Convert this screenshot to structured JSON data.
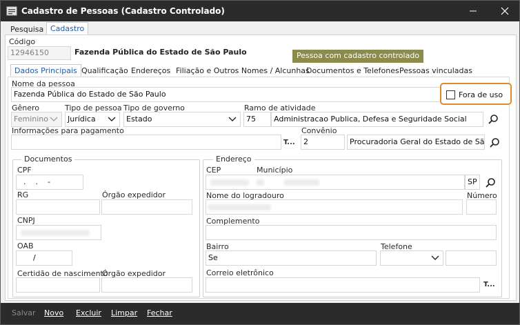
{
  "window": {
    "title": "Cadastro de Pessoas (Cadastro Controlado)",
    "minimize": "—",
    "maximize": "☐",
    "close": "✕"
  },
  "tabs": {
    "main": [
      "Pesquisa",
      "Cadastro"
    ],
    "active_main": "Cadastro",
    "sub": [
      "Dados Principais",
      "Qualificação",
      "Endereços",
      "Filiação e Outros Nomes / Alcunhas",
      "Documentos e Telefones",
      "Pessoas vinculadas"
    ],
    "active_sub": "Dados Principais"
  },
  "header": {
    "codigo_label": "Código",
    "codigo_value": "12946150",
    "entity_name": "Fazenda Pública do Estado de São Paulo",
    "badge": "Pessoa com cadastro controlado"
  },
  "form": {
    "nome_label": "Nome da pessoa",
    "nome_value": "Fazenda Pública do Estado de São Paulo",
    "fora_de_uso_label": "Fora de uso",
    "fora_de_uso_checked": false,
    "genero_label": "Gênero",
    "genero_value": "Feminino",
    "tipo_pessoa_label": "Tipo de pessoa",
    "tipo_pessoa_value": "Jurídica",
    "tipo_governo_label": "Tipo de governo",
    "tipo_governo_value": "Estado",
    "ramo_label": "Ramo de atividade",
    "ramo_code": "75",
    "ramo_desc": "Administracao Publica, Defesa e Seguridade Social",
    "info_pagamento_label": "Informações para pagamento",
    "info_pagamento_btn": "T...",
    "convenio_label": "Convênio",
    "convenio_code": "2",
    "convenio_desc": "Procuradoria Geral do Estado de São P"
  },
  "documentos": {
    "title": "Documentos",
    "cpf_label": "CPF",
    "cpf_value": "  .    .    -",
    "rg_label": "RG",
    "orgao_expedidor_label": "Órgão expedidor",
    "cnpj_label": "CNPJ",
    "oab_label": "OAB",
    "oab_value": "/",
    "certidao_label": "Certidão de nascimento",
    "orgao_expedidor2_label": "Órgão expedidor"
  },
  "endereco": {
    "title": "Endereço",
    "cep_label": "CEP",
    "municipio_label": "Município",
    "uf_value": "SP",
    "logradouro_label": "Nome do logradouro",
    "numero_label": "Número",
    "complemento_label": "Complemento",
    "bairro_label": "Bairro",
    "bairro_value": "Se",
    "telefone_label": "Telefone",
    "email_label": "Correio eletrônico",
    "email_btn": "T..."
  },
  "footer": {
    "salvar": "Salvar",
    "novo": "Novo",
    "excluir": "Excluir",
    "limpar": "Limpar",
    "fechar": "Fechar"
  },
  "colors": {
    "titlebar": "#2b2b2b",
    "badge": "#8b8b4c",
    "highlight": "#e08a2a",
    "active_tab_text": "#1f5aa6"
  }
}
